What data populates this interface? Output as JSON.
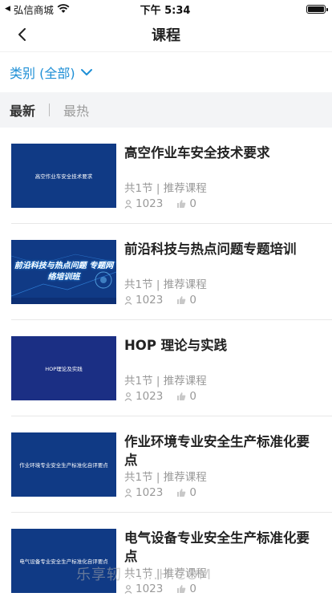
{
  "status": {
    "carrier": "弘信商城",
    "time": "下午 5:34"
  },
  "nav": {
    "title": "课程"
  },
  "filter": {
    "label": "类别 (全部)"
  },
  "tabs": [
    {
      "label": "最新",
      "active": true
    },
    {
      "label": "最热",
      "active": false
    }
  ],
  "courses": [
    {
      "title": "高空作业车安全技术要求",
      "thumb_text": "高空作业车安全技术要求",
      "meta": "共1节 | 推荐课程",
      "learners": "1023",
      "likes": "0"
    },
    {
      "title": "前沿科技与热点问题专题培训",
      "thumb_text": "前沿科技与热点问题 专题网络培训班",
      "meta": "共1节 | 推荐课程",
      "learners": "1023",
      "likes": "0"
    },
    {
      "title": "HOP 理论与实践",
      "thumb_text": "HOP理论及实践",
      "meta": "共1节 | 推荐课程",
      "learners": "1023",
      "likes": "0"
    },
    {
      "title": "作业环境专业安全生产标准化要点",
      "thumb_text": "作业环境专业安全生产标准化自评要点",
      "meta": "共1节 | 推荐课程",
      "learners": "1023",
      "likes": "0"
    },
    {
      "title": "电气设备专业安全生产标准化要点",
      "thumb_text": "电气设备专业安全生产标准化自评要点",
      "meta": "共1节 | 推荐课程",
      "learners": "1023",
      "likes": "0"
    }
  ],
  "watermark": "乐享轫 . ….H.COM",
  "icons": {
    "back": "chevron-left-icon",
    "filter": "chevron-down-icon",
    "learners": "person-icon",
    "likes": "thumbs-up-icon"
  },
  "colors": {
    "accent": "#1e8fd6",
    "thumb_bg": "#103a85",
    "tabs_bg": "#f3f4f6"
  }
}
